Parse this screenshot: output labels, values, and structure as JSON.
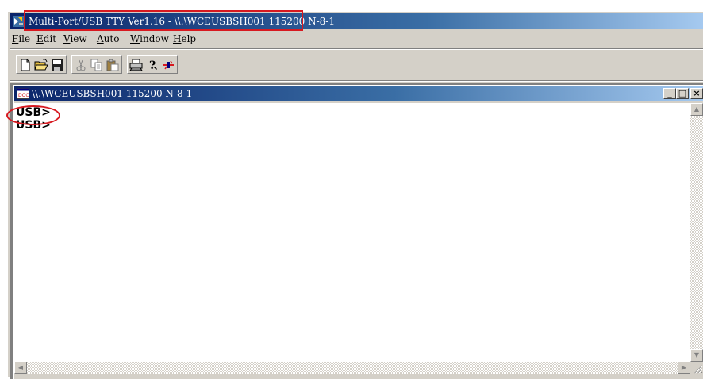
{
  "window": {
    "title": "Multi-Port/USB TTY Ver1.16 - \\\\.\\WCEUSBSH001 115200  N-8-1"
  },
  "menu": [
    {
      "label": "File",
      "underline": "F",
      "rest": "ile"
    },
    {
      "label": "Edit",
      "underline": "E",
      "rest": "dit"
    },
    {
      "label": "View",
      "underline": "V",
      "rest": "iew"
    },
    {
      "label": "Auto",
      "underline": "A",
      "rest": "uto"
    },
    {
      "label": "Window",
      "underline": "W",
      "rest": "indow"
    },
    {
      "label": "Help",
      "underline": "H",
      "rest": "elp"
    }
  ],
  "toolbar": {
    "icons": [
      "new-file-icon",
      "open-folder-icon",
      "save-disk-icon",
      "cut-icon",
      "copy-icon",
      "paste-icon",
      "print-icon",
      "help-icon",
      "connect-icon"
    ]
  },
  "child_window": {
    "title": "\\\\.\\WCEUSBSH001 115200  N-8-1",
    "minimize": "_",
    "restore": "□",
    "close": "×"
  },
  "terminal": {
    "lines": [
      "USB>",
      "USB>"
    ]
  },
  "annotation_color": "#d71920"
}
